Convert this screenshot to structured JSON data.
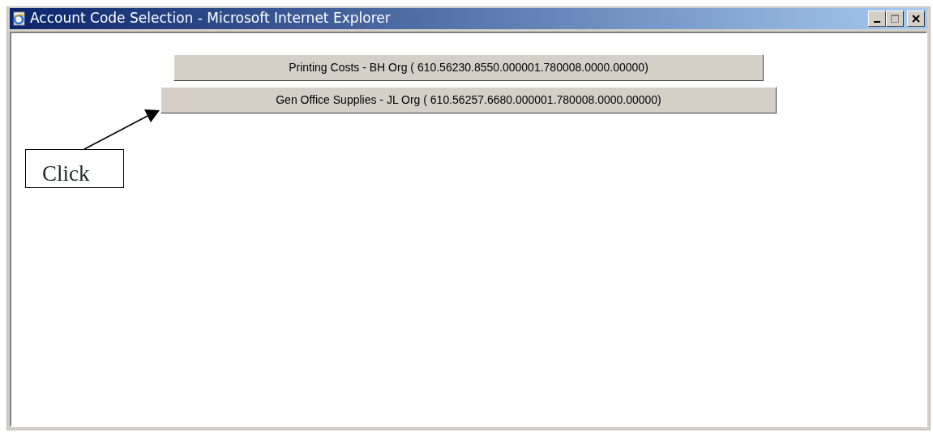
{
  "window": {
    "title": "Account Code Selection - Microsoft Internet Explorer"
  },
  "buttons": [
    {
      "label": "Printing Costs - BH Org ( 610.56230.8550.000001.780008.0000.00000)"
    },
    {
      "label": "Gen Office Supplies - JL Org ( 610.56257.6680.000001.780008.0000.00000)"
    }
  ],
  "callout": {
    "text": "Click"
  }
}
